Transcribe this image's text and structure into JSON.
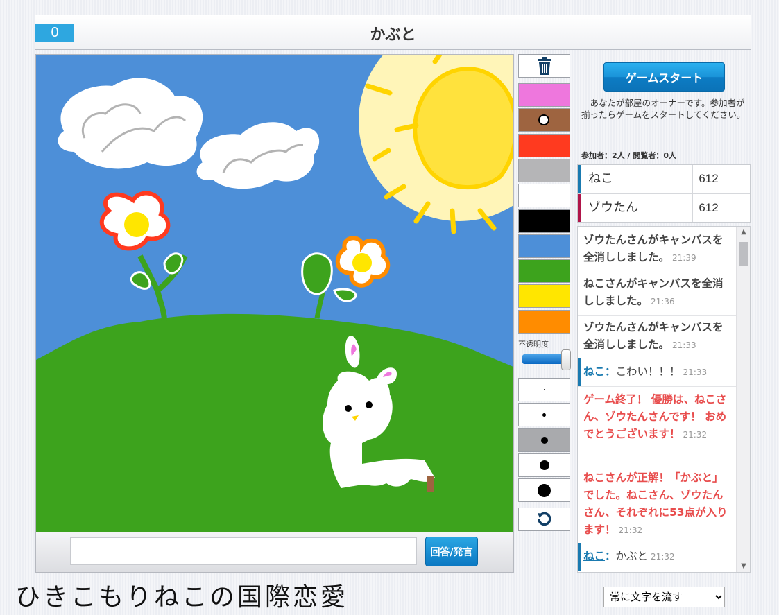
{
  "header": {
    "score": "0",
    "word": "かぶと"
  },
  "answer": {
    "placeholder": "",
    "button_label": "回答/発言"
  },
  "toolbox": {
    "colors": [
      "#ee77dd",
      "#9e6440",
      "#ff3a1f",
      "#b5b5b7",
      "#ffffff",
      "#000000",
      "#4d8fd8",
      "#3da31d",
      "#ffe600",
      "#ff8c00"
    ],
    "selected_color_index": 1,
    "opacity_label": "不透明度",
    "brush_sizes": [
      2,
      5,
      10,
      14,
      19
    ],
    "selected_brush_index": 2,
    "icons": {
      "trash": "trash-icon",
      "undo": "undo-icon"
    }
  },
  "side": {
    "start_button": "ゲームスタート",
    "owner_message": "あなたが部屋のオーナーです。参加者が揃ったらゲームをスタートしてください。",
    "counts": "参加者：2人 / 閲覧者：0人",
    "players": [
      {
        "name": "ねこ",
        "score": "612",
        "color": "#1a7ab0"
      },
      {
        "name": "ゾウたん",
        "score": "612",
        "color": "#b0154a"
      }
    ]
  },
  "chat": [
    {
      "type": "system",
      "text": "ゾウたんさんがキャンバスを全消ししました。",
      "time": "21:39"
    },
    {
      "type": "system",
      "text": "ねこさんがキャンバスを全消ししました。",
      "time": "21:36"
    },
    {
      "type": "system",
      "text": "ゾウたんさんがキャンバスを全消ししました。",
      "time": "21:33"
    },
    {
      "type": "user",
      "user": "ねこ",
      "colon": "：",
      "text": "こわい！！！",
      "time": "21:33"
    },
    {
      "type": "alert",
      "text": "ゲーム終了！ 優勝は、ねこさん、ゾウたんさんです！ おめでとうございます！",
      "time": "21:32"
    },
    {
      "type": "alert",
      "text": "ねこさんが正解！「かぶと」でした。ねこさん、ゾウたんさん、それぞれに53点が入ります！",
      "time": "21:32"
    },
    {
      "type": "user",
      "user": "ねこ",
      "colon": "：",
      "text": "かぶと",
      "time": "21:32"
    }
  ],
  "footer": {
    "logo": "ひきこもりねこの国際恋愛",
    "mode_selected": "常に文字を流す"
  }
}
